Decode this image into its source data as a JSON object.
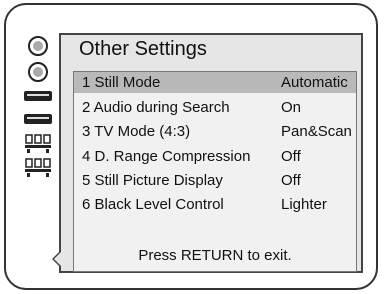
{
  "menu": {
    "title": "Other Settings",
    "items": [
      {
        "label": "1 Still Mode",
        "value": "Automatic"
      },
      {
        "label": "2 Audio during Search",
        "value": "On"
      },
      {
        "label": "3 TV Mode (4:3)",
        "value": "Pan&Scan"
      },
      {
        "label": "4 D. Range Compression",
        "value": "Off"
      },
      {
        "label": "5 Still Picture Display",
        "value": "Off"
      },
      {
        "label": "6 Black Level Control",
        "value": "Lighter"
      }
    ],
    "footer": "Press RETURN to exit."
  },
  "side_icons": [
    "disc-icon",
    "disc-icon",
    "player-deck-icon",
    "player-deck-icon",
    "speaker-setup-icon",
    "speaker-setup-icon"
  ]
}
